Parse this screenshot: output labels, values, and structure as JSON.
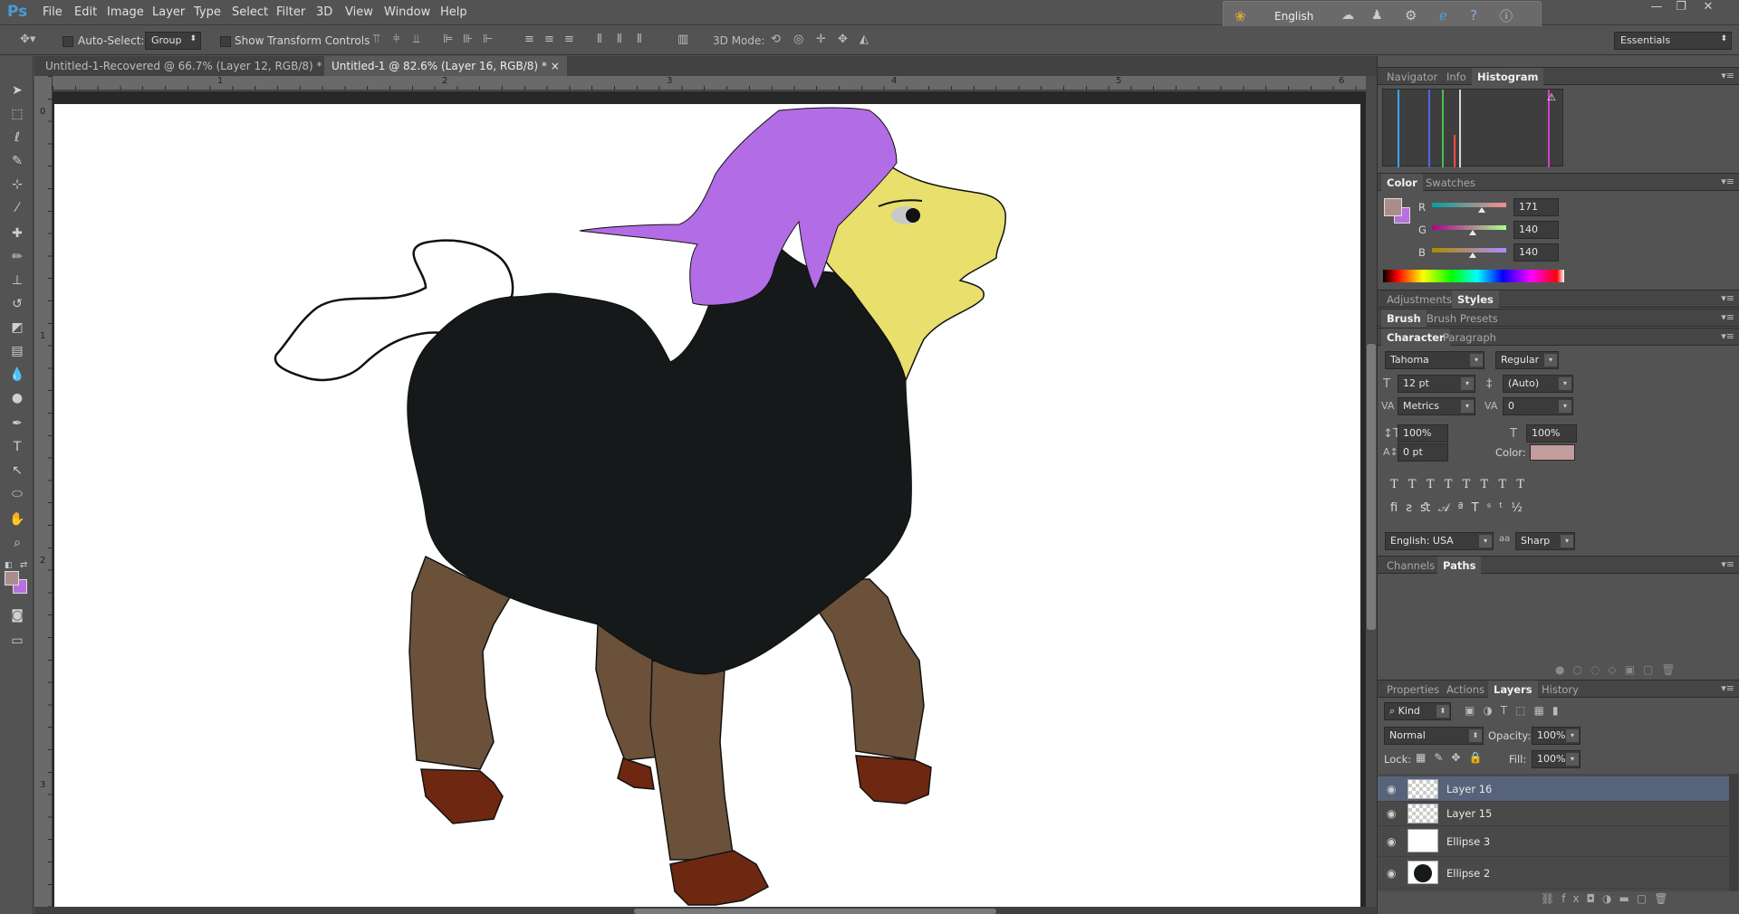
{
  "app": {
    "logo": "Ps"
  },
  "menu": [
    "File",
    "Edit",
    "Image",
    "Layer",
    "Type",
    "Select",
    "Filter",
    "3D",
    "View",
    "Window",
    "Help"
  ],
  "ime": {
    "language": "English"
  },
  "options": {
    "auto_select_label": "Auto-Select:",
    "auto_select_value": "Group",
    "transform_label": "Show Transform Controls",
    "mode3d_label": "3D Mode:",
    "workspace": "Essentials"
  },
  "tabs": [
    {
      "label": "Untitled-1-Recovered @ 66.7% (Layer 12, RGB/8) *",
      "active": false
    },
    {
      "label": "Untitled-1 @ 82.6% (Layer 16, RGB/8) *",
      "active": true
    }
  ],
  "ruler": {
    "h": [
      "1",
      "2",
      "3",
      "4",
      "5",
      "6"
    ],
    "v": [
      "0",
      "1",
      "2",
      "3"
    ]
  },
  "panels": {
    "top_tabs": [
      "Navigator",
      "Info",
      "Histogram"
    ],
    "color_tabs": [
      "Color",
      "Swatches"
    ],
    "color": {
      "fg": "#ab8c8c",
      "bg": "#b86fe0",
      "channels": [
        {
          "label": "R",
          "value": "171",
          "level": 0.67
        },
        {
          "label": "G",
          "value": "140",
          "level": 0.55
        },
        {
          "label": "B",
          "value": "140",
          "level": 0.55
        }
      ]
    },
    "adj_tabs": [
      "Adjustments",
      "Styles"
    ],
    "brush_tabs": [
      "Brush",
      "Brush Presets"
    ],
    "char_tabs": [
      "Character",
      "Paragraph"
    ],
    "character": {
      "font": "Tahoma",
      "style": "Regular",
      "size": "12 pt",
      "leading": "(Auto)",
      "kerning": "Metrics",
      "tracking": "0",
      "vscale": "100%",
      "hscale": "100%",
      "baseline": "0 pt",
      "color_label": "Color:",
      "color": "#c29d9d",
      "language": "English: USA",
      "aa_icon": "aa",
      "antialias": "Sharp"
    },
    "path_tabs": [
      "Channels",
      "Paths"
    ],
    "layer_tabs": [
      "Properties",
      "Actions",
      "Layers",
      "History"
    ],
    "layers": {
      "kind": "Kind",
      "blend": "Normal",
      "opacity_label": "Opacity:",
      "opacity": "100%",
      "lock_label": "Lock:",
      "fill_label": "Fill:",
      "fill": "100%",
      "items": [
        {
          "name": "Layer 16",
          "selected": true
        },
        {
          "name": "Layer 15",
          "selected": false
        },
        {
          "name": "Ellipse 3",
          "selected": false
        },
        {
          "name": "Ellipse 2",
          "selected": false
        }
      ]
    }
  },
  "drawing_colors": {
    "mane": "#b26ce5",
    "head": "#e8df6d",
    "body": "#161919",
    "legs": "#6b513a",
    "hooves": "#6e2812"
  }
}
